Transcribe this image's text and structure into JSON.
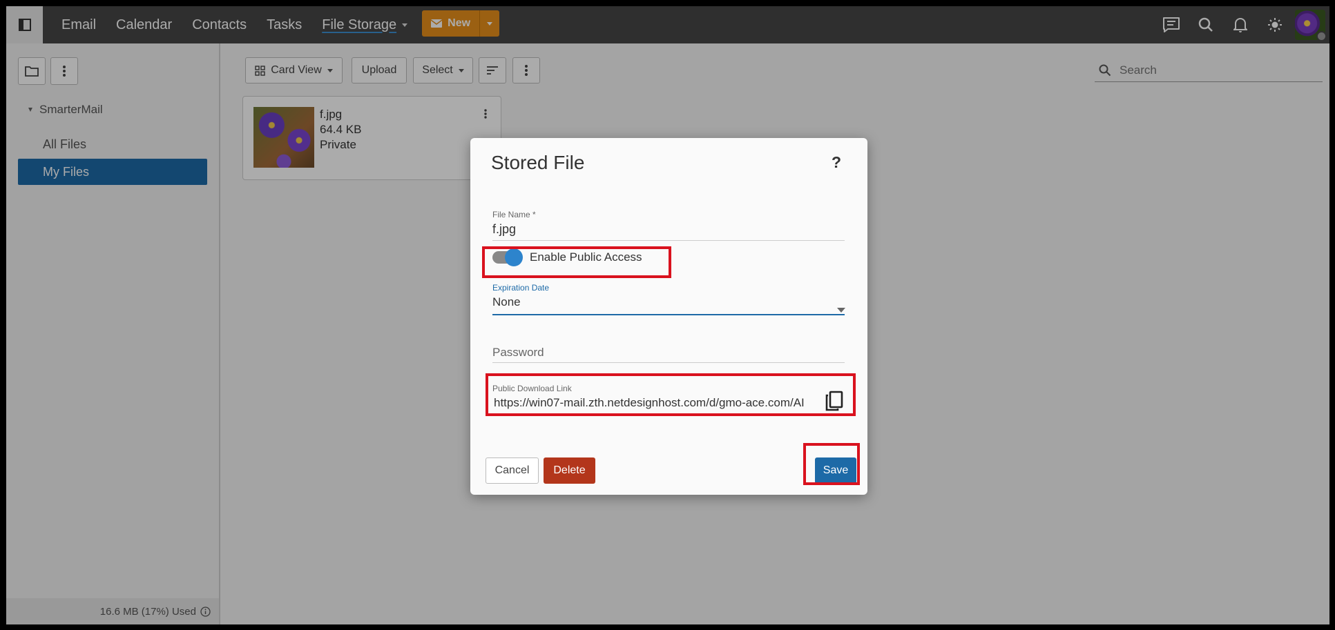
{
  "nav": {
    "items": [
      "Email",
      "Calendar",
      "Contacts",
      "Tasks"
    ],
    "active": "File Storage",
    "new_label": "New"
  },
  "sidebar": {
    "root": "SmarterMail",
    "items": [
      "All Files",
      "My Files"
    ],
    "usage": "16.6 MB (17%) Used"
  },
  "toolbar": {
    "view_label": "Card View",
    "upload_label": "Upload",
    "select_label": "Select",
    "search_placeholder": "Search"
  },
  "file": {
    "name": "f.jpg",
    "size": "64.4 KB",
    "visibility": "Private"
  },
  "modal": {
    "title": "Stored File",
    "help": "?",
    "file_name_label": "File Name *",
    "file_name_value": "f.jpg",
    "public_access_label": "Enable Public Access",
    "public_access_enabled": true,
    "expiration_label": "Expiration Date",
    "expiration_value": "None",
    "password_placeholder": "Password",
    "download_link_label": "Public Download Link",
    "download_link_value": "https://win07-mail.zth.netdesignhost.com/d/gmo-ace.com/AI",
    "cancel_label": "Cancel",
    "delete_label": "Delete",
    "save_label": "Save"
  },
  "colors": {
    "accent": "#1d6aa7",
    "new_button": "#e8901c",
    "delete_button": "#b3361b",
    "highlight": "#d9121e"
  }
}
